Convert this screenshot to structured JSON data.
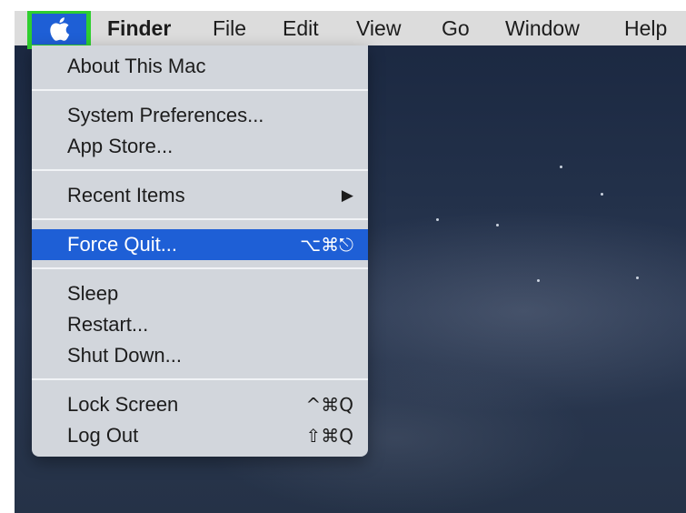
{
  "menubar": {
    "apple_icon": "apple-logo-icon",
    "highlight_color": "#2fce2f",
    "selected_color": "#1e5fd6",
    "items": [
      "Finder",
      "File",
      "Edit",
      "View",
      "Go",
      "Window",
      "Help"
    ]
  },
  "apple_menu": {
    "items": [
      {
        "label": "About This Mac"
      },
      {
        "label": "System Preferences..."
      },
      {
        "label": "App Store..."
      },
      {
        "label": "Recent Items",
        "submenu_icon": "▶"
      },
      {
        "label": "Force Quit...",
        "shortcut": "⌥⌘⎋",
        "highlighted": true
      },
      {
        "label": "Sleep"
      },
      {
        "label": "Restart..."
      },
      {
        "label": "Shut Down..."
      },
      {
        "label": "Lock Screen",
        "shortcut": "^⌘Q"
      },
      {
        "label": "Log Out",
        "shortcut": "⇧⌘Q"
      }
    ]
  }
}
